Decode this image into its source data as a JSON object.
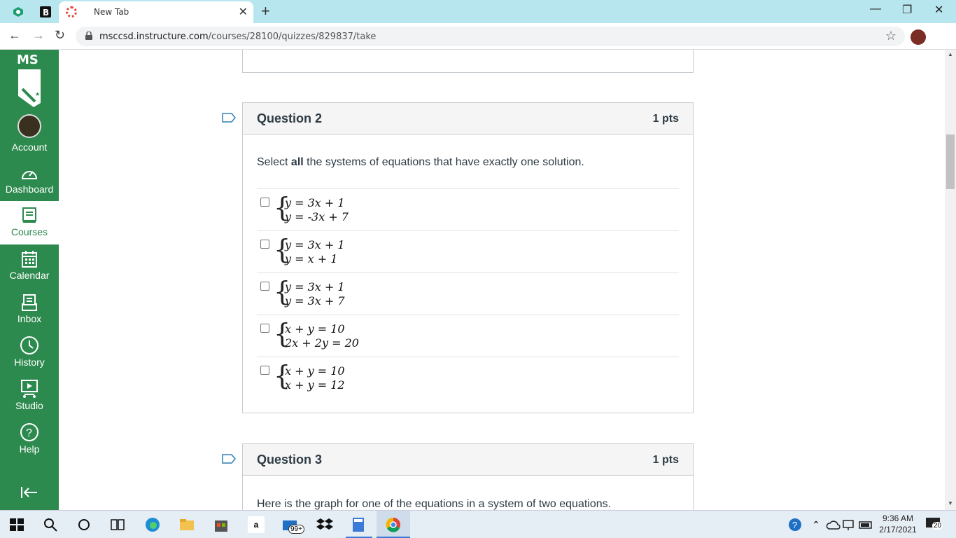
{
  "browser": {
    "tab_title": "New Tab",
    "url_host": "msccsd.instructure.com",
    "url_path": "/courses/28100/quizzes/829837/take",
    "minimize": "—",
    "maximize": "❐",
    "close": "✕",
    "new_tab": "+",
    "tab_close": "✕"
  },
  "sidebar": {
    "logo": "MS",
    "items": [
      {
        "label": "Account",
        "icon": "avatar-icon"
      },
      {
        "label": "Dashboard",
        "icon": "dashboard-icon"
      },
      {
        "label": "Courses",
        "icon": "courses-icon"
      },
      {
        "label": "Calendar",
        "icon": "calendar-icon"
      },
      {
        "label": "Inbox",
        "icon": "inbox-icon"
      },
      {
        "label": "History",
        "icon": "history-icon"
      },
      {
        "label": "Studio",
        "icon": "studio-icon"
      },
      {
        "label": "Help",
        "icon": "help-icon"
      }
    ],
    "collapse_icon": "collapse-icon",
    "bg_color": "#2d8a4e"
  },
  "question2": {
    "title": "Question 2",
    "points": "1 pts",
    "prompt_pre": "Select ",
    "prompt_bold": "all",
    "prompt_post": " the systems of equations that have exactly one solution.",
    "answers": [
      {
        "eq1": "y = 3x + 1",
        "eq2": "y = -3x + 7"
      },
      {
        "eq1": "y = 3x + 1",
        "eq2": "y = x + 1"
      },
      {
        "eq1": "y = 3x + 1",
        "eq2": "y = 3x + 7"
      },
      {
        "eq1": "x + y = 10",
        "eq2": "2x + 2y = 20"
      },
      {
        "eq1": "x + y = 10",
        "eq2": "x + y = 12"
      }
    ]
  },
  "question3": {
    "title": "Question 3",
    "points": "1 pts",
    "prompt": "Here is the graph for one of the equations in a system of two equations."
  },
  "taskbar": {
    "time": "9:36 AM",
    "date": "2/17/2021",
    "mail_badge": "99+",
    "notification_count": "20",
    "amazon_label": "a"
  }
}
